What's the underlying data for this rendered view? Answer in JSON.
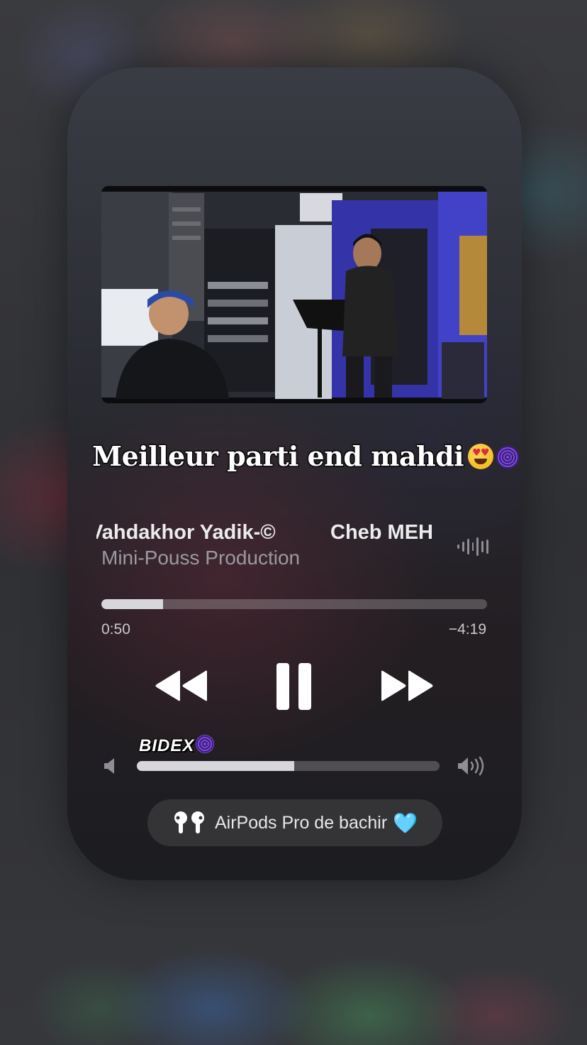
{
  "caption": {
    "text": "Meilleur parti end mahdi",
    "emojis": [
      "heart-eyes-emoji",
      "fingerprint-emoji"
    ]
  },
  "now_playing": {
    "title_part1": "Vahdakhor Yadik-©",
    "title_part2": "Cheb MEH",
    "artist": "Mini-Pouss Production",
    "elapsed": "0:50",
    "remaining": "−4:19",
    "progress_fraction": 0.16
  },
  "controls": {
    "rewind_icon": "rewind-icon",
    "pause_icon": "pause-icon",
    "forward_icon": "fast-forward-icon"
  },
  "watermark": {
    "text": "BIDEX"
  },
  "volume": {
    "level_fraction": 0.52
  },
  "output_device": {
    "label": "AirPods Pro de bachir",
    "heart": "🩵",
    "icon": "airpods-icon"
  },
  "colors": {
    "progress_fill": "#d7d7db",
    "track": "rgba(255,255,255,0.22)",
    "secondary_text": "#9a9aa0"
  }
}
